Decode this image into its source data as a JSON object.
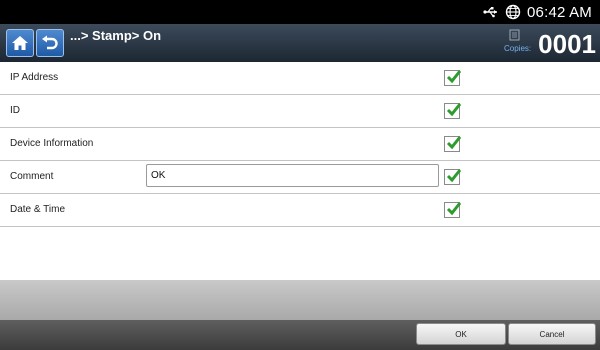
{
  "status_bar": {
    "time": "06:42 AM",
    "icons": [
      "usb-icon",
      "globe-icon"
    ]
  },
  "header": {
    "title": "...> Stamp> On",
    "copies_label": "Copies:",
    "copies_count": "0001",
    "buttons": [
      "home-icon",
      "back-icon"
    ]
  },
  "rows": [
    {
      "label": "IP Address",
      "checked": true
    },
    {
      "label": "ID",
      "checked": true
    },
    {
      "label": "Device Information",
      "checked": true
    },
    {
      "label": "Comment",
      "checked": true,
      "input_value": "OK"
    },
    {
      "label": "Date & Time",
      "checked": true
    }
  ],
  "footer": {
    "ok_label": "OK",
    "cancel_label": "Cancel"
  },
  "colors": {
    "header_top": "#3c4a5b",
    "check_green": "#2e9b2e",
    "copies_label": "#76b2ec"
  }
}
